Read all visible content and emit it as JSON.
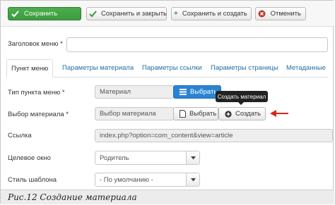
{
  "toolbar": {
    "save_label": "Сохранить",
    "save_close_label": "Сохранить и закрыть",
    "save_new_label": "Сохранить и создать",
    "cancel_label": "Отменить"
  },
  "form": {
    "menu_title_label": "Заголовок меню *",
    "menu_title_value": ""
  },
  "tabs": [
    {
      "label": "Пункт меню",
      "active": true
    },
    {
      "label": "Параметры материала"
    },
    {
      "label": "Параметры ссылки"
    },
    {
      "label": "Параметры страницы"
    },
    {
      "label": "Метаданные"
    }
  ],
  "fields": {
    "item_type_label": "Тип пункта меню *",
    "item_type_value": "Материал",
    "item_type_select_btn": "Выбрать",
    "article_label": "Выбор материала *",
    "article_value": "Выбор материала",
    "article_select_btn": "Выбрать",
    "article_create_btn": "Создать",
    "create_tooltip": "Создать материал",
    "link_label": "Ссылка",
    "link_value": "index.php?option=com_content&view=article",
    "target_label": "Целевое окно",
    "target_value": "Родитель",
    "template_label": "Стиль шаблона",
    "template_value": "- По умолчанию -"
  },
  "caption": "Рис.12  Создание материала",
  "colors": {
    "save_green": "#46a546",
    "select_blue": "#2a84d2",
    "cancel_red": "#c0392b",
    "arrow_red": "#d9261c"
  }
}
